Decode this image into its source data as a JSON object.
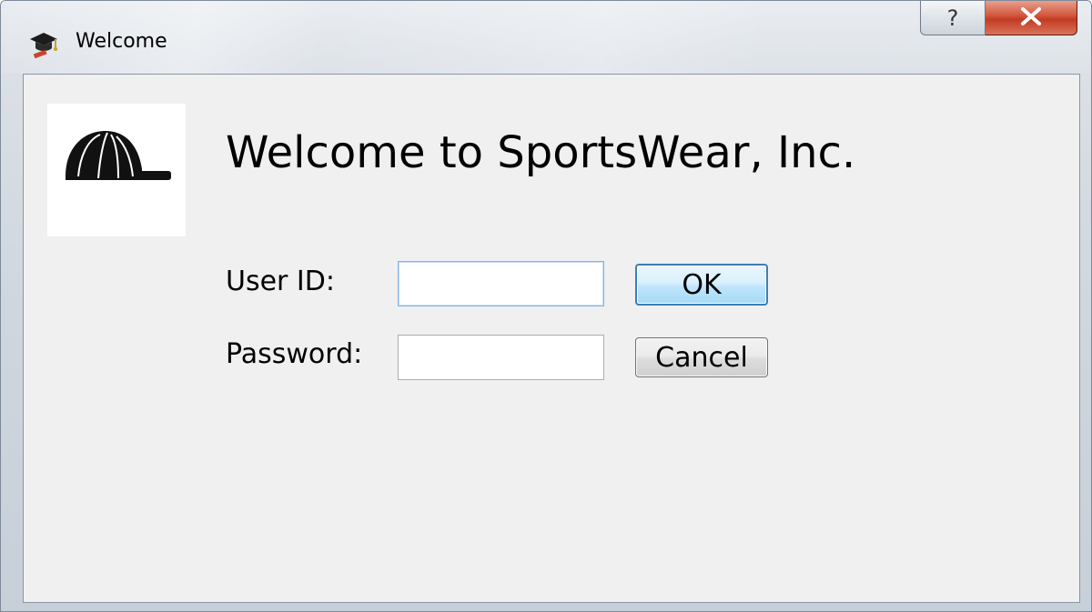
{
  "window": {
    "title": "Welcome",
    "icon": "graduation-cap-icon",
    "help_glyph": "?",
    "close_glyph": "X"
  },
  "logo": {
    "icon": "baseball-cap-icon"
  },
  "main": {
    "heading": "Welcome to SportsWear, Inc."
  },
  "form": {
    "user_id_label": "User ID:",
    "user_id_value": "",
    "password_label": "Password:",
    "password_value": "",
    "ok_label": "OK",
    "cancel_label": "Cancel"
  },
  "colors": {
    "dialog_background": "#f0f0f0",
    "close_button": "#c23b22",
    "default_button_border": "#3c7fb1"
  }
}
